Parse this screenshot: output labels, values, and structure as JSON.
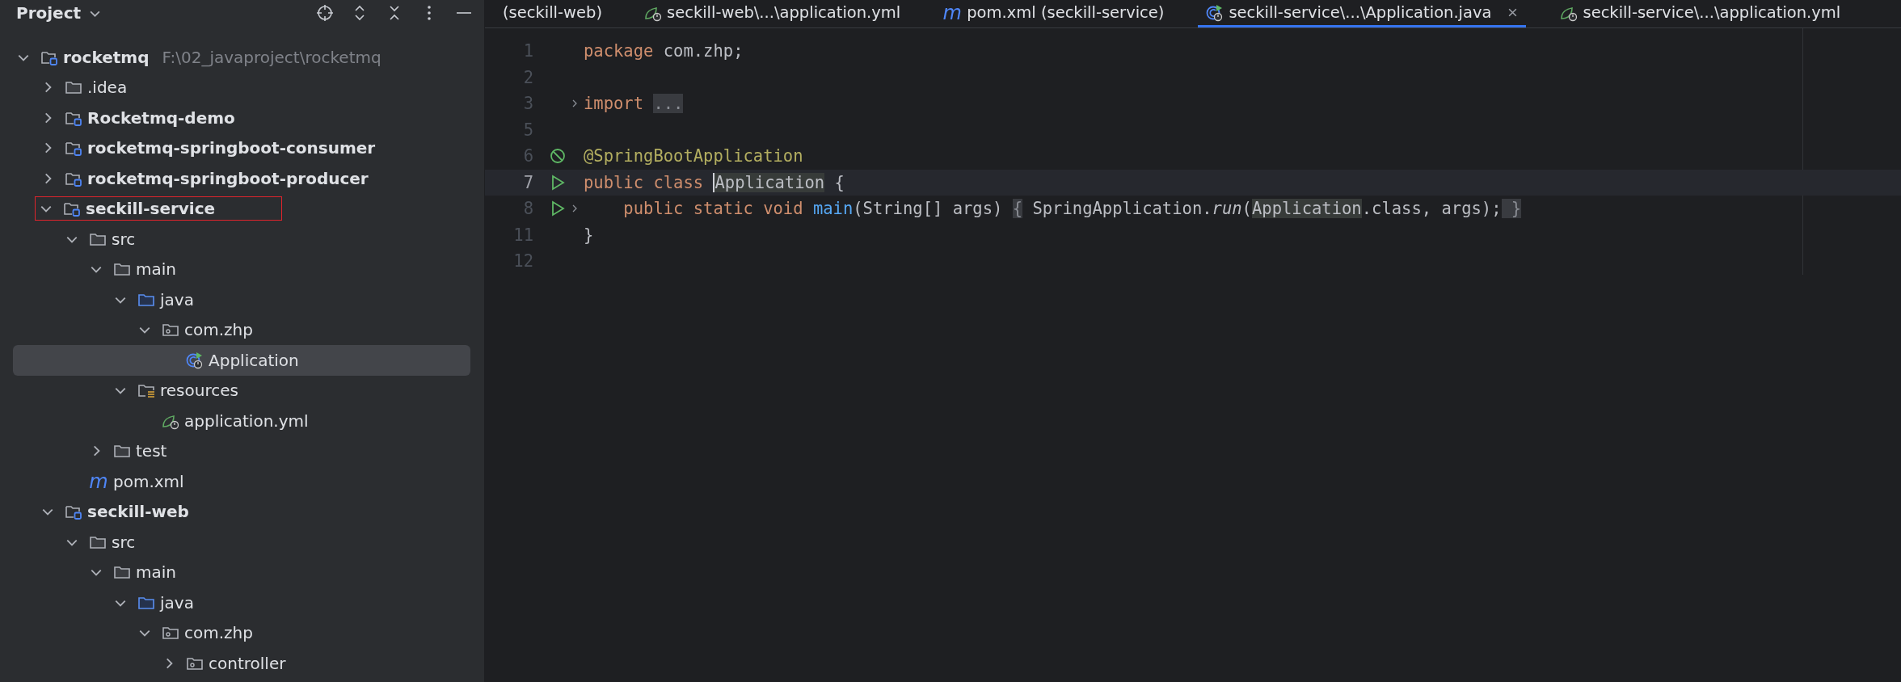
{
  "project_panel": {
    "title": "Project",
    "tree": [
      {
        "label": "rocketmq",
        "path": "F:\\02_javaproject\\rocketmq",
        "kind": "module",
        "bold": true,
        "expanded": true,
        "selected": false,
        "highlighted": false,
        "children": [
          {
            "label": ".idea",
            "kind": "folder",
            "bold": false,
            "expanded": false,
            "selected": false,
            "highlighted": false
          },
          {
            "label": "Rocketmq-demo",
            "kind": "module",
            "bold": true,
            "expanded": false,
            "selected": false,
            "highlighted": false
          },
          {
            "label": "rocketmq-springboot-consumer",
            "kind": "module",
            "bold": true,
            "expanded": false,
            "selected": false,
            "highlighted": false
          },
          {
            "label": "rocketmq-springboot-producer",
            "kind": "module",
            "bold": true,
            "expanded": false,
            "selected": false,
            "highlighted": false
          },
          {
            "label": "seckill-service",
            "kind": "module",
            "bold": true,
            "expanded": true,
            "selected": false,
            "highlighted": true,
            "children": [
              {
                "label": "src",
                "kind": "folder",
                "bold": false,
                "expanded": true,
                "selected": false,
                "highlighted": false,
                "children": [
                  {
                    "label": "main",
                    "kind": "folder",
                    "bold": false,
                    "expanded": true,
                    "selected": false,
                    "highlighted": false,
                    "children": [
                      {
                        "label": "java",
                        "kind": "source",
                        "bold": false,
                        "expanded": true,
                        "selected": false,
                        "highlighted": false,
                        "children": [
                          {
                            "label": "com.zhp",
                            "kind": "package",
                            "bold": false,
                            "expanded": true,
                            "selected": false,
                            "highlighted": false,
                            "children": [
                              {
                                "label": "Application",
                                "kind": "class",
                                "bold": false,
                                "selected": true,
                                "highlighted": false
                              }
                            ]
                          }
                        ]
                      },
                      {
                        "label": "resources",
                        "kind": "resources",
                        "bold": false,
                        "expanded": true,
                        "selected": false,
                        "highlighted": false,
                        "children": [
                          {
                            "label": "application.yml",
                            "kind": "spring",
                            "bold": false,
                            "selected": false,
                            "highlighted": false
                          }
                        ]
                      }
                    ]
                  },
                  {
                    "label": "test",
                    "kind": "folder",
                    "bold": false,
                    "expanded": false,
                    "selected": false,
                    "highlighted": false
                  }
                ]
              },
              {
                "label": "pom.xml",
                "kind": "maven",
                "glyph": "m",
                "bold": false,
                "selected": false,
                "highlighted": false
              }
            ]
          },
          {
            "label": "seckill-web",
            "kind": "module",
            "bold": true,
            "expanded": true,
            "selected": false,
            "highlighted": false,
            "children": [
              {
                "label": "src",
                "kind": "folder",
                "bold": false,
                "expanded": true,
                "selected": false,
                "highlighted": false,
                "children": [
                  {
                    "label": "main",
                    "kind": "folder",
                    "bold": false,
                    "expanded": true,
                    "selected": false,
                    "highlighted": false,
                    "children": [
                      {
                        "label": "java",
                        "kind": "source",
                        "bold": false,
                        "expanded": true,
                        "selected": false,
                        "highlighted": false,
                        "children": [
                          {
                            "label": "com.zhp",
                            "kind": "package",
                            "bold": false,
                            "expanded": true,
                            "selected": false,
                            "highlighted": false,
                            "children": [
                              {
                                "label": "controller",
                                "kind": "package",
                                "bold": false,
                                "expanded": false,
                                "selected": false,
                                "highlighted": false
                              }
                            ]
                          }
                        ]
                      }
                    ]
                  }
                ]
              }
            ]
          }
        ]
      }
    ]
  },
  "editor_tabs": [
    {
      "label": "(seckill-web)",
      "selected": false
    },
    {
      "label": "seckill-web\\...\\application.yml",
      "kind": "spring",
      "selected": false
    },
    {
      "label": "pom.xml (seckill-service)",
      "kind": "maven",
      "glyph": "m",
      "selected": false
    },
    {
      "label": "seckill-service\\...\\Application.java",
      "kind": "class",
      "selected": true
    },
    {
      "label": "seckill-service\\...\\application.yml",
      "kind": "spring",
      "selected": false
    }
  ],
  "code_lines": [
    {
      "number": "1",
      "runnable": false,
      "bean": false,
      "fold": false,
      "current": false,
      "tokens": [
        {
          "text": "package",
          "kind": "keyword"
        },
        {
          "text": " com.zhp;",
          "kind": "plain"
        }
      ]
    },
    {
      "number": "2",
      "runnable": false,
      "bean": false,
      "fold": false,
      "current": false
    },
    {
      "number": "3",
      "runnable": false,
      "bean": false,
      "fold": true,
      "current": false,
      "tokens": [
        {
          "text": "import ",
          "kind": "keyword"
        },
        {
          "text": "...",
          "kind": "folded"
        }
      ]
    },
    {
      "number": "5",
      "runnable": false,
      "bean": false,
      "fold": false,
      "current": false
    },
    {
      "number": "6",
      "runnable": false,
      "bean": true,
      "fold": false,
      "current": false,
      "tokens": [
        {
          "text": "@SpringBootApplication",
          "kind": "annotation"
        }
      ]
    },
    {
      "number": "7",
      "runnable": true,
      "bean": false,
      "fold": false,
      "current": true,
      "tokens": [
        {
          "text": "public class ",
          "kind": "keyword"
        },
        {
          "text": "Application",
          "kind": "usage",
          "caret": true
        },
        {
          "text": " {",
          "kind": "plain"
        }
      ]
    },
    {
      "number": "8",
      "runnable": true,
      "bean": false,
      "fold": true,
      "current": false,
      "tokens": [
        {
          "text": "    public static void ",
          "kind": "keyword"
        },
        {
          "text": "main",
          "kind": "method"
        },
        {
          "text": "(String[] args) ",
          "kind": "plain"
        },
        {
          "text": "{",
          "kind": "folded"
        },
        {
          "text": " SpringApplication.",
          "kind": "plain"
        },
        {
          "text": "run",
          "kind": "static"
        },
        {
          "text": "(",
          "kind": "plain"
        },
        {
          "text": "Application",
          "kind": "usage"
        },
        {
          "text": ".class, args);",
          "kind": "plain"
        },
        {
          "text": " }",
          "kind": "folded"
        }
      ]
    },
    {
      "number": "11",
      "runnable": false,
      "bean": false,
      "fold": false,
      "current": false,
      "tokens": [
        {
          "text": "}",
          "kind": "plain"
        }
      ]
    },
    {
      "number": "12",
      "runnable": false,
      "bean": false,
      "fold": false,
      "current": false
    }
  ]
}
